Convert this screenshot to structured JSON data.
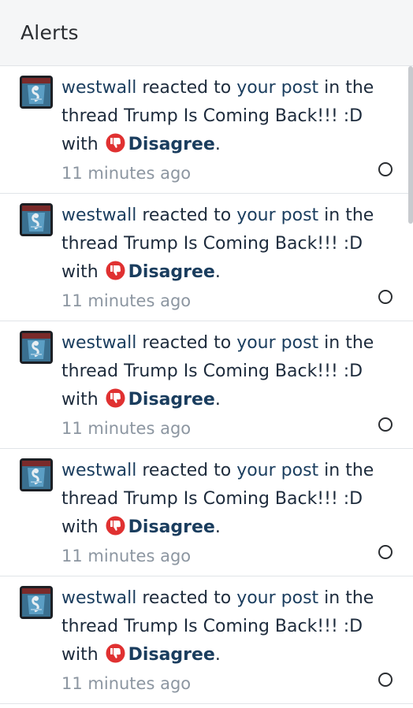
{
  "header": {
    "title": "Alerts"
  },
  "alerts": [
    {
      "user": "westwall",
      "action": " reacted to ",
      "post_link": "your post",
      "mid": " in the thread ",
      "thread": "Trump Is Coming Back!!! :D",
      "with": " with ",
      "reaction": "Disagree",
      "period": ".",
      "time": "11 minutes ago"
    },
    {
      "user": "westwall",
      "action": " reacted to ",
      "post_link": "your post",
      "mid": " in the thread ",
      "thread": "Trump Is Coming Back!!! :D",
      "with": " with ",
      "reaction": "Disagree",
      "period": ".",
      "time": "11 minutes ago"
    },
    {
      "user": "westwall",
      "action": " reacted to ",
      "post_link": "your post",
      "mid": " in the thread ",
      "thread": "Trump Is Coming Back!!! :D",
      "with": " with ",
      "reaction": "Disagree",
      "period": ".",
      "time": "11 minutes ago"
    },
    {
      "user": "westwall",
      "action": " reacted to ",
      "post_link": "your post",
      "mid": " in the thread ",
      "thread": "Trump Is Coming Back!!! :D",
      "with": " with ",
      "reaction": "Disagree",
      "period": ".",
      "time": "11 minutes ago"
    },
    {
      "user": "westwall",
      "action": " reacted to ",
      "post_link": "your post",
      "mid": " in the thread ",
      "thread": "Trump Is Coming Back!!! :D",
      "with": " with ",
      "reaction": "Disagree",
      "period": ".",
      "time": "11 minutes ago"
    }
  ],
  "icons": {
    "reaction": "thumbs-down-icon",
    "unread": "circle-outline-icon"
  },
  "colors": {
    "link": "#1a3d5e",
    "reaction_icon": "#e03131",
    "time": "#8c96a1",
    "header_bg": "#f5f6f7"
  }
}
